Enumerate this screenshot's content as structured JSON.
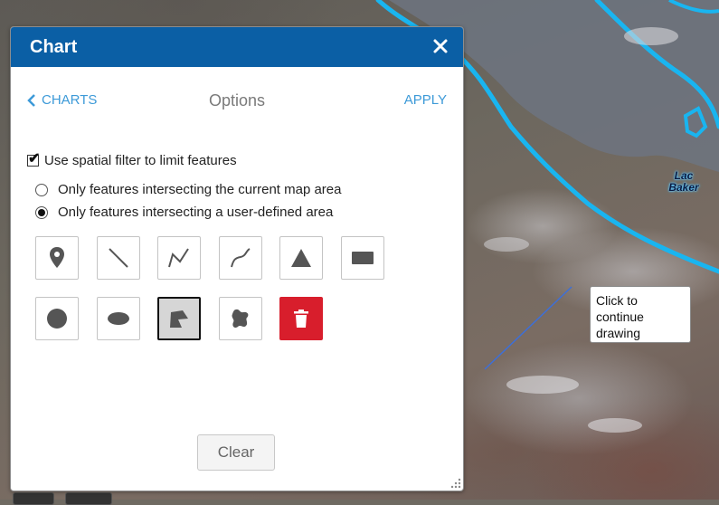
{
  "dialog": {
    "title": "Chart",
    "close_glyph": "✕",
    "nav": {
      "back_label": "CHARTS",
      "title": "Options",
      "apply_label": "APPLY"
    },
    "spatial_filter": {
      "label": "Use spatial filter to limit features",
      "checked": true,
      "options": [
        {
          "label": "Only features intersecting the current map area",
          "selected": false
        },
        {
          "label": "Only features intersecting a user-defined area",
          "selected": true
        }
      ]
    },
    "tools": [
      {
        "name": "point",
        "icon": "map-pin-icon"
      },
      {
        "name": "line",
        "icon": "line-icon"
      },
      {
        "name": "polyline",
        "icon": "polyline-icon"
      },
      {
        "name": "freehand-polyline",
        "icon": "freehand-line-icon"
      },
      {
        "name": "triangle",
        "icon": "triangle-icon"
      },
      {
        "name": "rectangle",
        "icon": "rectangle-icon"
      },
      {
        "name": "circle",
        "icon": "circle-icon"
      },
      {
        "name": "ellipse",
        "icon": "ellipse-icon"
      },
      {
        "name": "polygon",
        "icon": "polygon-icon",
        "active": true
      },
      {
        "name": "freehand-polygon",
        "icon": "freehand-polygon-icon"
      },
      {
        "name": "delete",
        "icon": "trash-icon",
        "color": "#d81e2c"
      }
    ],
    "clear_label": "Clear"
  },
  "map": {
    "lake_label": "Lac Baker",
    "tooltip": "Click to continue drawing",
    "water_color": "#19b5f0"
  },
  "colors": {
    "header": "#0b5fa5",
    "link": "#3d9ad8",
    "delete": "#d81e2c"
  }
}
